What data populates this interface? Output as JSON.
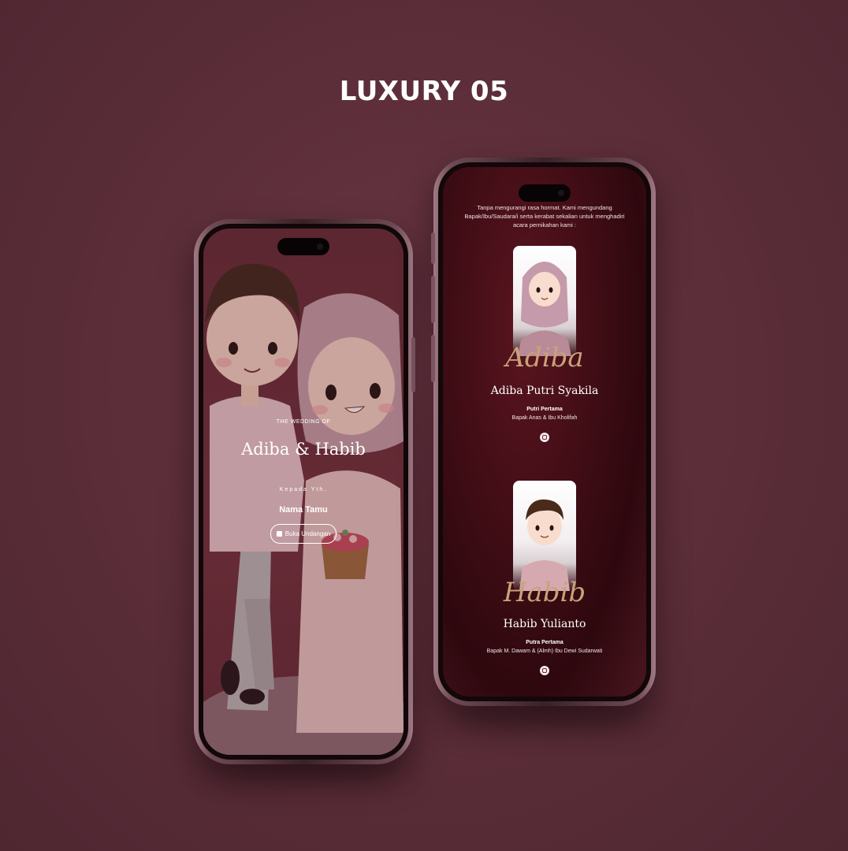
{
  "heading": "LUXURY 05",
  "left_screen": {
    "kicker": "THE WEDDING OF",
    "couple": "Adiba & Habib",
    "to_label": "Kepada Yth.",
    "guest_name": "Nama Tamu",
    "open_button": "Buka Undangan",
    "open_icon": "envelope-icon"
  },
  "right_screen": {
    "intro": "Tanpa mengurangi rasa hormat. Kami mengundang Bapak/Ibu/Saudara/i serta kerabat sekalian untuk menghadiri acara pernikahan kami :",
    "bride": {
      "script": "Adiba",
      "full_name": "Adiba Putri Syakila",
      "role": "Putri Pertama",
      "parents": "Bapak Anas & Ibu Kholifah",
      "icon": "instagram-icon"
    },
    "groom": {
      "script": "Habib",
      "full_name": "Habib Yulianto",
      "role": "Putra Pertama",
      "parents": "Bapak M. Dawam & (Almh) Ibu Dewi Sudarwati",
      "icon": "instagram-icon"
    }
  },
  "colors": {
    "background": "#5a2d38",
    "accent_gold": "#c9a27a",
    "screen_dark": "#3e0c14"
  }
}
